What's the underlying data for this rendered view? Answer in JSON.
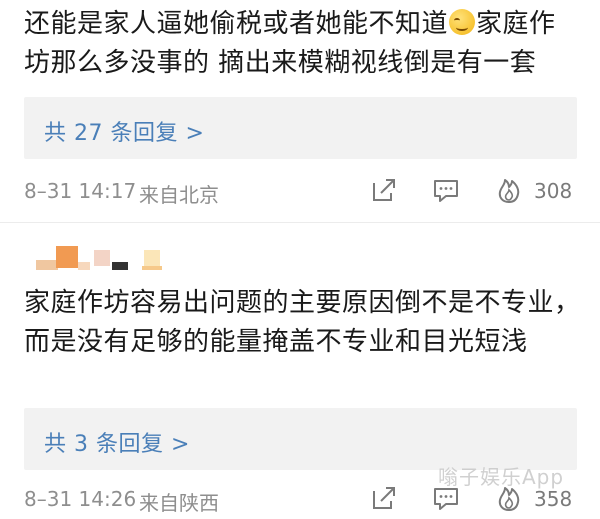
{
  "comments": [
    {
      "text_part1": "还能是家人逼她偷税或者她能不知道",
      "text_part2": "家庭作坊那么多没事的  摘出来模糊视线倒是有一套",
      "emoji_icon": "grinning-sweat-emoji",
      "reply_link": "共 27 条回复 >",
      "time": "8–31 14:17",
      "location": "来自北京",
      "like_count": "308"
    },
    {
      "text": "家庭作坊容易出问题的主要原因倒不是不专业，而是没有足够的能量掩盖不专业和目光短浅",
      "reply_link": "共 3 条回复 >",
      "time": "8–31 14:26",
      "location": "来自陕西",
      "like_count": "358"
    }
  ],
  "watermark": "嗡子娱乐App",
  "colors": {
    "reply_link": "#4a7fb8",
    "reply_bg": "#f2f2f2",
    "meta_text": "#8e8e8e",
    "body_text": "#1a1a1a"
  },
  "icons": [
    "share-icon",
    "comment-icon",
    "fire-like-icon"
  ]
}
